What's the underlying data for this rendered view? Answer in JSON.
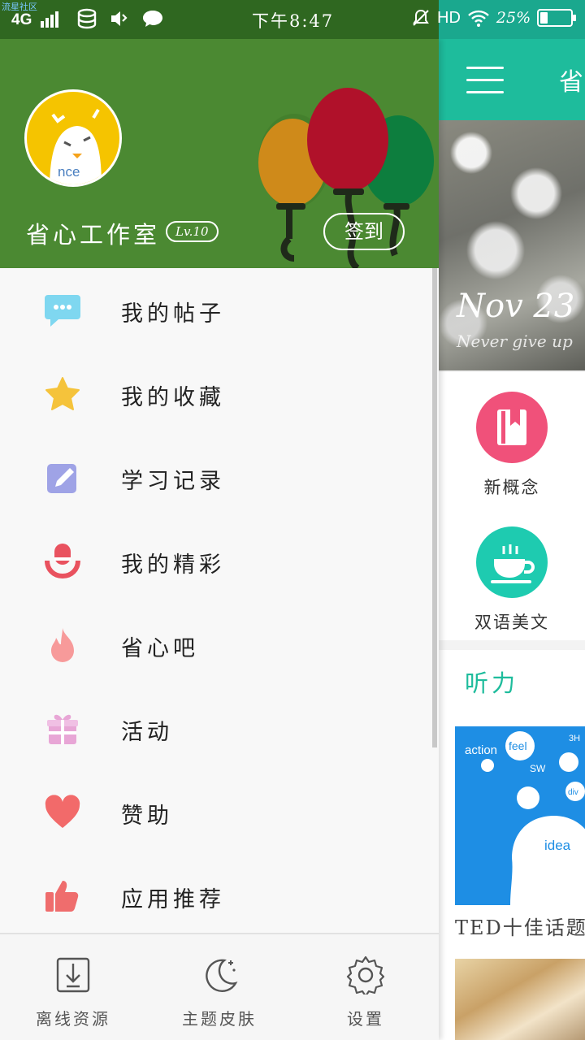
{
  "status_bar": {
    "watermark": "流星社区",
    "network": "4G",
    "time": "下午8:47",
    "hd": "HD",
    "battery": "25%",
    "battery_level": 0.25,
    "icons": [
      "signal-icon",
      "storage-icon",
      "volume-icon",
      "message-icon",
      "mute-icon",
      "wifi-icon",
      "battery-icon"
    ]
  },
  "drawer": {
    "profile": {
      "avatar_text": "nce",
      "username": "省心工作室",
      "level": "Lv.10",
      "signin_label": "签到"
    },
    "menu": [
      {
        "label": "我的帖子",
        "icon": "chat-bubble-icon",
        "color": "#7fd7f0"
      },
      {
        "label": "我的收藏",
        "icon": "star-icon",
        "color": "#f5c33b"
      },
      {
        "label": "学习记录",
        "icon": "edit-icon",
        "color": "#9fa3e6"
      },
      {
        "label": "我的精彩",
        "icon": "microphone-icon",
        "color": "#e9525f"
      },
      {
        "label": "省心吧",
        "icon": "flame-icon",
        "color": "#f79a9a"
      },
      {
        "label": "活动",
        "icon": "gift-icon",
        "color": "#e8a6d6"
      },
      {
        "label": "赞助",
        "icon": "heart-icon",
        "color": "#f26a6a"
      },
      {
        "label": "应用推荐",
        "icon": "thumbs-up-icon",
        "color": "#ef6d6d"
      }
    ],
    "bottom_bar": [
      {
        "label": "离线资源",
        "icon": "download-icon"
      },
      {
        "label": "主题皮肤",
        "icon": "moon-icon"
      },
      {
        "label": "设置",
        "icon": "gear-icon"
      }
    ]
  },
  "background_app": {
    "title": "省",
    "banner": {
      "date": "Nov 23",
      "motto": "Never give up"
    },
    "categories": [
      {
        "label": "新概念",
        "icon": "book-icon",
        "color": "#f0517a"
      },
      {
        "label": "双语美文",
        "icon": "coffee-cup-icon",
        "color": "#1ecbb0"
      }
    ],
    "section_title": "听力",
    "ted": {
      "caption": "TED十佳话题",
      "image_words": [
        "action",
        "feel",
        "SW",
        "3H",
        "idea",
        "div"
      ]
    }
  },
  "colors": {
    "header_green": "#4b8932",
    "accent_teal": "#1ebc9c"
  }
}
